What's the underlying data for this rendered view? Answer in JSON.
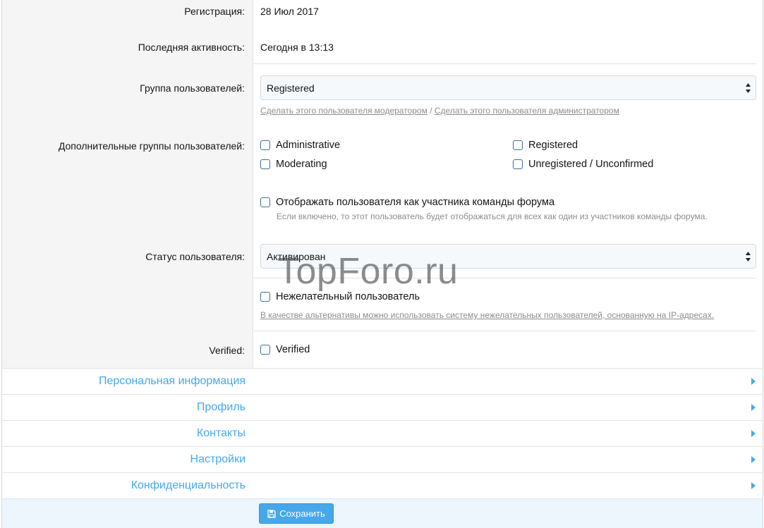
{
  "info": {
    "registration_label": "Регистрация:",
    "registration_value": "28 Июл 2017",
    "last_activity_label": "Последняя активность:",
    "last_activity_value": "Сегодня в 13:13"
  },
  "user_group": {
    "label": "Группа пользователей:",
    "value": "Registered",
    "link_moderator": "Сделать этого пользователя модератором",
    "separator": "/",
    "link_admin": "Сделать этого пользователя администратором"
  },
  "additional_groups": {
    "label": "Дополнительные группы пользователей:",
    "options": [
      "Administrative",
      "Registered",
      "Moderating",
      "Unregistered / Unconfirmed"
    ]
  },
  "staff": {
    "label": "Отображать пользователя как участника команды форума",
    "note": "Если включено, то этот пользователь будет отображаться для всех как один из участников команды форума."
  },
  "status": {
    "label": "Статус пользователя:",
    "value": "Активирован"
  },
  "discouraged": {
    "label": "Нежелательный пользователь",
    "note": "В качестве альтернативы можно использовать систему нежелательных пользователей, основанную на IP-адресах."
  },
  "verified": {
    "label": "Verified:",
    "checkbox_label": "Verified"
  },
  "sections": [
    "Персональная информация",
    "Профиль",
    "Контакты",
    "Настройки",
    "Конфиденциальность"
  ],
  "footer": {
    "save_label": "Сохранить"
  },
  "watermark": "TopForo.ru",
  "colors": {
    "accent": "#47a7eb",
    "link_gray": "#8c8c8c",
    "label_bg": "#f5f5f5",
    "footer_bg": "#edf6fd"
  }
}
